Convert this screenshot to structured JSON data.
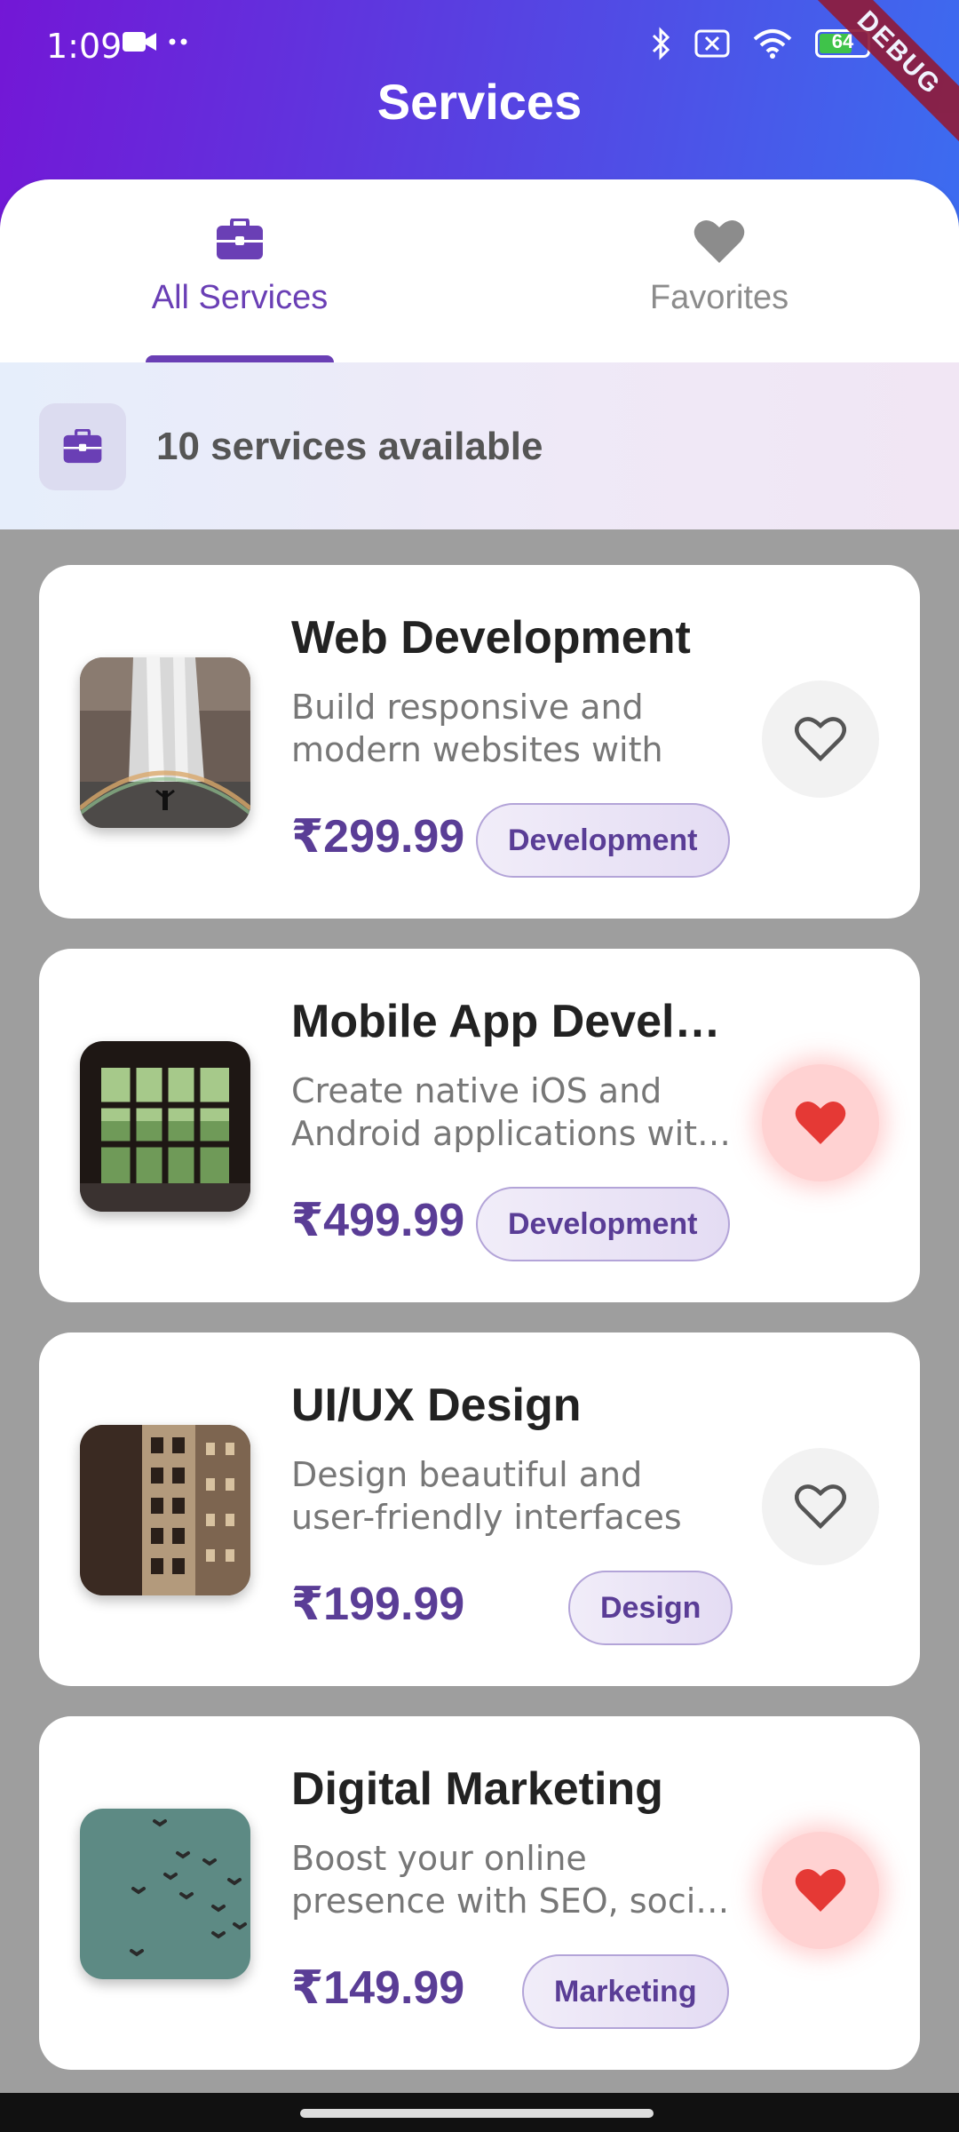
{
  "status_bar": {
    "time": "1:09",
    "battery": "64"
  },
  "debug_label": "DEBUG",
  "page_title": "Services",
  "tabs": [
    {
      "label": "All Services",
      "icon": "briefcase-icon",
      "selected": true
    },
    {
      "label": "Favorites",
      "icon": "heart-icon",
      "selected": false
    }
  ],
  "info_banner": {
    "text": "10 services available",
    "icon": "briefcase-icon"
  },
  "services": [
    {
      "title": "Web Development",
      "description": "Build responsive and modern websites with la…",
      "price": "₹299.99",
      "category": "Development",
      "favorite": false,
      "image": "waterfall-image"
    },
    {
      "title": "Mobile App Devel…",
      "description": "Create native iOS and Android applications wit…",
      "price": "₹499.99",
      "category": "Development",
      "favorite": true,
      "image": "window-forest-image"
    },
    {
      "title": "UI/UX Design",
      "description": "Design beautiful and user-friendly interfaces with …",
      "price": "₹199.99",
      "category": "Design",
      "favorite": false,
      "image": "building-image"
    },
    {
      "title": "Digital Marketing",
      "description": "Boost your online presence with SEO, soci…",
      "price": "₹149.99",
      "category": "Marketing",
      "favorite": true,
      "image": "birds-sky-image"
    }
  ],
  "colors": {
    "accent": "#6a3fb5",
    "favorite_red": "#e53935",
    "header_start": "#7317d6",
    "header_end": "#3c6cf0"
  }
}
